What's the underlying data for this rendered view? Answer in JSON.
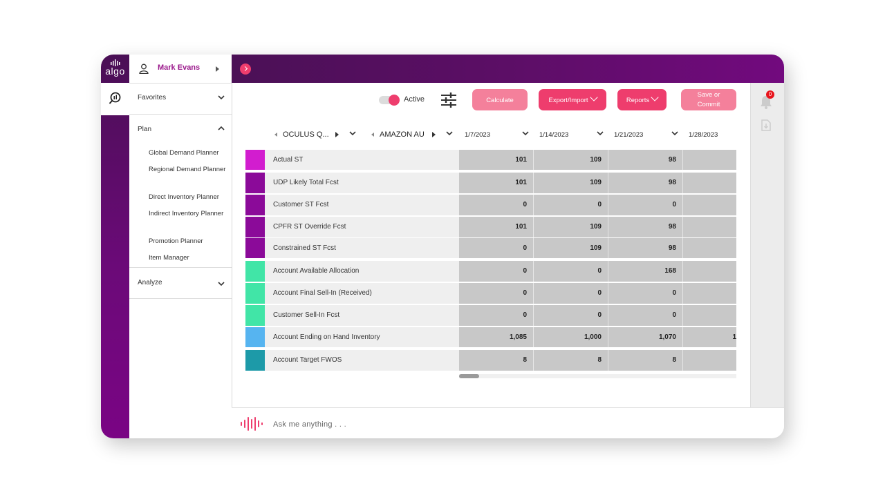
{
  "brand": {
    "logo_text": "algo"
  },
  "user": {
    "name": "Mark Evans"
  },
  "nav": {
    "favorites": "Favorites",
    "plan": "Plan",
    "plan_items": [
      "Global Demand Planner",
      "Regional Demand Planner",
      "Direct Inventory Planner",
      "Indirect Inventory Planner",
      "Promotion Planner",
      "Item Manager"
    ],
    "analyze": "Analyze"
  },
  "toolbar": {
    "active_label": "Active",
    "calculate": "Calculate",
    "export_import": "Export/Import",
    "reports": "Reports",
    "save_line1": "Save or",
    "save_line2": "Commit"
  },
  "notifications": {
    "count": "0"
  },
  "grid": {
    "product_filter": "OCULUS Q...",
    "account_filter": "AMAZON AU",
    "dates": [
      "1/7/2023",
      "1/14/2023",
      "1/21/2023",
      "1/28/2023"
    ],
    "rows": [
      {
        "label": "Actual ST",
        "color": "#d21dcf",
        "values": [
          "101",
          "109",
          "98",
          ""
        ]
      },
      {
        "label": "UDP Likely Total Fcst",
        "color": "#8b0a99",
        "values": [
          "101",
          "109",
          "98",
          ""
        ]
      },
      {
        "label": "Customer ST Fcst",
        "color": "#8b0a99",
        "values": [
          "0",
          "0",
          "0",
          ""
        ]
      },
      {
        "label": "CPFR ST Override Fcst",
        "color": "#8b0a99",
        "values": [
          "101",
          "109",
          "98",
          ""
        ]
      },
      {
        "label": "Constrained ST Fcst",
        "color": "#8b0a99",
        "values": [
          "0",
          "109",
          "98",
          ""
        ]
      },
      {
        "label": "Account Available Allocation",
        "color": "#41e5a7",
        "values": [
          "0",
          "0",
          "168",
          ""
        ]
      },
      {
        "label": "Account Final Sell-In (Received)",
        "color": "#41e5a7",
        "values": [
          "0",
          "0",
          "0",
          ""
        ]
      },
      {
        "label": "Customer Sell-In Fcst",
        "color": "#41e5a7",
        "values": [
          "0",
          "0",
          "0",
          ""
        ]
      },
      {
        "label": "Account Ending on Hand Inventory",
        "color": "#56b4f0",
        "values": [
          "1,085",
          "1,000",
          "1,070",
          "1"
        ]
      },
      {
        "label": "Account Target FWOS",
        "color": "#1d9aa8",
        "values": [
          "8",
          "8",
          "8",
          ""
        ]
      }
    ]
  },
  "ask": {
    "placeholder": "Ask me anything . . ."
  }
}
